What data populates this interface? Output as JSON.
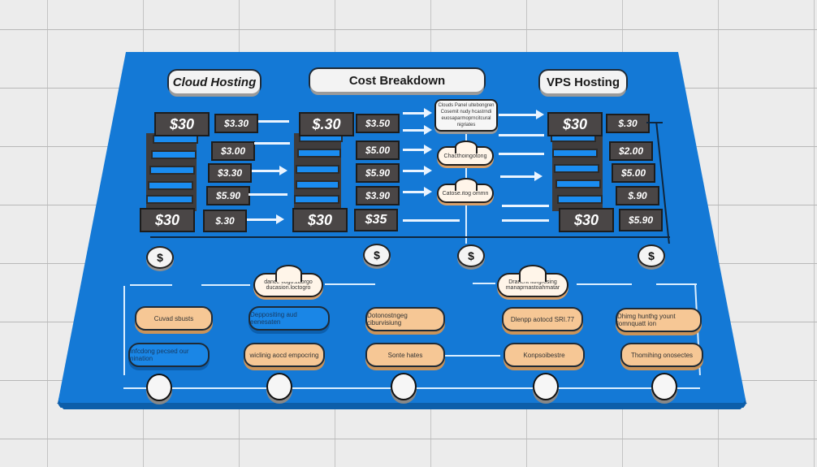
{
  "headers": {
    "left": "Cloud Hosting",
    "center": "Cost Breakdown",
    "right": "VPS Hosting"
  },
  "columns": {
    "cloud_stack": {
      "top": "$30",
      "bottom": "$30"
    },
    "cloud_prices": [
      "$3.30",
      "$3.00",
      "$3.30",
      "$5.90",
      "$.30"
    ],
    "mid_stack": {
      "top": "$.30",
      "bottom": "$30"
    },
    "mid_prices": [
      "$3.50",
      "$5.00",
      "$5.90",
      "$3.90",
      "$35"
    ],
    "vps_stack": {
      "top": "$30",
      "bottom": "$30"
    },
    "vps_prices": [
      "$.30",
      "$2.00",
      "$5.00",
      "$.90",
      "$5.90"
    ]
  },
  "center_flow": {
    "note": "Clouds Panel ultebongren Cosemit nudy hcastrndi euosaparmoprncitcural nigriates",
    "cloud_1": "Chacthoingotong",
    "cloud_2": "Catose.itog ommn"
  },
  "coins": [
    "$",
    "$",
    "$",
    "$"
  ],
  "mid_clouds": {
    "left": "dance flogo.zaorgo ducasion.loctogro",
    "right": "Dranerit itorgrosing manaprnastoahmatar"
  },
  "pills_top": [
    {
      "label": "Cuvad sbusts",
      "style": "orange"
    },
    {
      "label": "Deppositing aud eenesaten",
      "style": "blue"
    },
    {
      "label": "Dotonostngeg ciburvisiung",
      "style": "orange"
    },
    {
      "label": "Dlenpp aotocd SRI.77",
      "style": "orange"
    },
    {
      "label": "Dhimg hunthg yount lomnquatt ion",
      "style": "orange"
    }
  ],
  "pills_bottom": [
    {
      "label": "Infcdong pecsed our nination",
      "style": "blue"
    },
    {
      "label": "wiclinig aocd empocring",
      "style": "orange"
    },
    {
      "label": "Sonte hates",
      "style": "orange"
    },
    {
      "label": "Konpsoibestre",
      "style": "orange"
    },
    {
      "label": "Thomihing onosectes",
      "style": "orange"
    }
  ],
  "colors": {
    "board": "#1479d6",
    "orange_pill": "#f6c795",
    "dark_box": "#4a4646",
    "background": "#ececec"
  }
}
